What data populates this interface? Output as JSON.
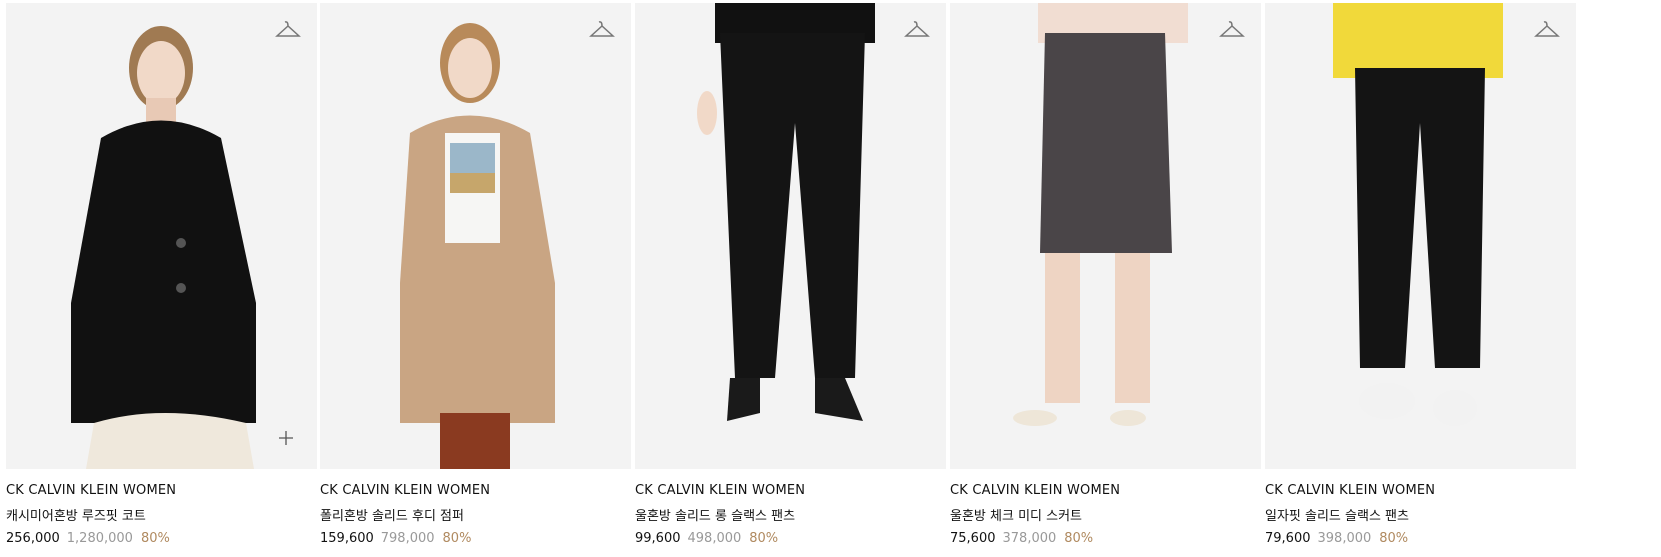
{
  "products": [
    {
      "brand": "CK CALVIN KLEIN WOMEN",
      "name": "캐시미어혼방 루즈핏 코트",
      "price": "256,000",
      "original_price": "1,280,000",
      "discount": "80%"
    },
    {
      "brand": "CK CALVIN KLEIN WOMEN",
      "name": "폴리혼방 솔리드 후디 점퍼",
      "price": "159,600",
      "original_price": "798,000",
      "discount": "80%"
    },
    {
      "brand": "CK CALVIN KLEIN WOMEN",
      "name": "울혼방 솔리드 롱 슬랙스 팬츠",
      "price": "99,600",
      "original_price": "498,000",
      "discount": "80%"
    },
    {
      "brand": "CK CALVIN KLEIN WOMEN",
      "name": "울혼방 체크 미디 스커트",
      "price": "75,600",
      "original_price": "378,000",
      "discount": "80%"
    },
    {
      "brand": "CK CALVIN KLEIN WOMEN",
      "name": "일자핏 솔리드 슬랙스 팬츠",
      "price": "79,600",
      "original_price": "398,000",
      "discount": "80%"
    }
  ],
  "icons": {
    "save": "hanger-icon",
    "add": "plus-icon"
  },
  "colors": {
    "discount": "#b08a60",
    "original_price": "#999999",
    "text": "#111111",
    "photo_bg": "#f3f3f3"
  }
}
